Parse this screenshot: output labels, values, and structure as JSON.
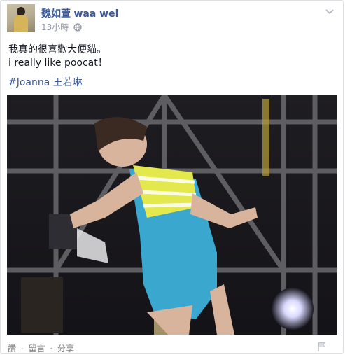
{
  "post": {
    "author_name": "魏如萱",
    "author_alias": "waa wei",
    "timestamp": "13小時",
    "audience_icon": "globe-icon",
    "menu_icon": "chevron-down-icon",
    "text_line1": "我真的很喜歡大便貓。",
    "text_line2": "i really like poocat！",
    "hashtag": "#Joanna",
    "hashtag_suffix": " 王若琳"
  },
  "media": {
    "type": "video",
    "description_icon": "video-thumbnail"
  },
  "actions": {
    "read": "讚",
    "comment": "留言",
    "share": "分享",
    "separator": "·",
    "flag_icon": "flag-icon"
  },
  "colors": {
    "link": "#3b5998",
    "meta": "#9197a3",
    "text": "#141823",
    "action": "#7f7f7f"
  }
}
